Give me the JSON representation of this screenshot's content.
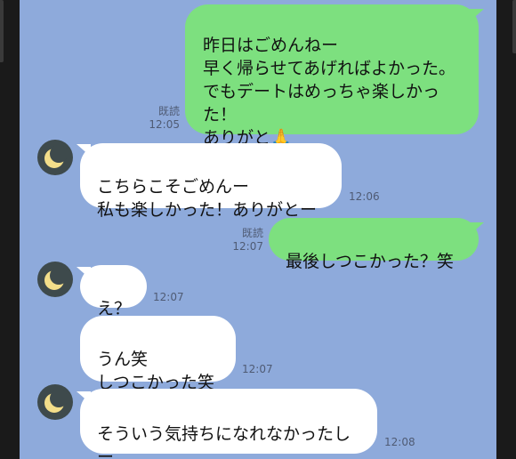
{
  "chat": {
    "messages": [
      {
        "id": "m1",
        "direction": "out",
        "text": "昨日はごめんねー\n早く帰らせてあげればよかった。\nでもデートはめっちゃ楽しかっ\nた！\nありがと🙏",
        "read_label": "既読",
        "time": "12:05"
      },
      {
        "id": "m2",
        "direction": "in",
        "text": "こちらこそごめんー\n私も楽しかった！ありがとー",
        "time": "12:06"
      },
      {
        "id": "m3",
        "direction": "out",
        "text": "最後しつこかった？笑",
        "read_label": "既読",
        "time": "12:07"
      },
      {
        "id": "m4",
        "direction": "in",
        "text": "え？",
        "time": "12:07"
      },
      {
        "id": "m5",
        "direction": "in",
        "text": "うん笑\nしつこかった笑",
        "time": "12:07"
      },
      {
        "id": "m6",
        "direction": "in",
        "text": "そういう気持ちになれなかったし\nー",
        "time": "12:08"
      }
    ],
    "avatar_icon": "crescent-moon-icon",
    "colors": {
      "background": "#8eaadb",
      "outgoing_bubble": "#7de07f",
      "incoming_bubble": "#ffffff",
      "avatar_bg": "#3e4a4c",
      "moon": "#f3de8a"
    }
  }
}
